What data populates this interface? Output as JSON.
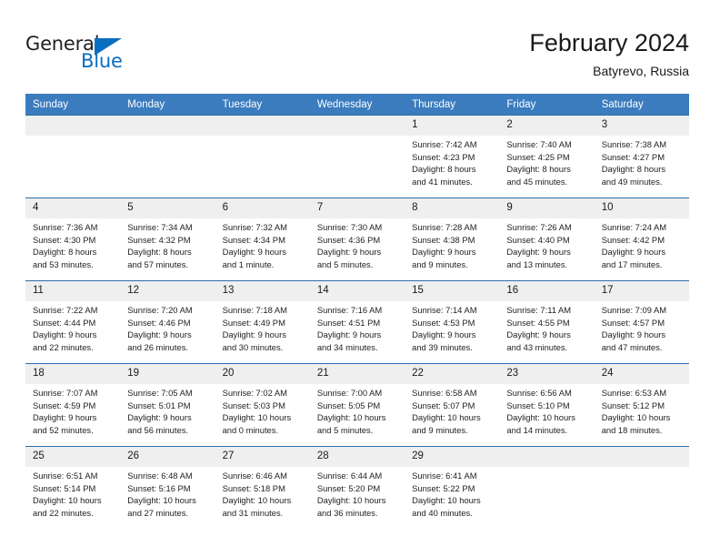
{
  "logo": {
    "word_top": "General",
    "word_bottom": "Blue",
    "triangle_icon": "blue-triangle-icon",
    "accent_color": "#0a6ec0",
    "text_color": "#231f20"
  },
  "header": {
    "title": "February 2024",
    "subtitle": "Batyrevo, Russia"
  },
  "theme": {
    "header_blue": "#3b7cbf",
    "row_divider_blue": "#2d6da8",
    "day_band_gray": "#efefef"
  },
  "weekdays": [
    "Sunday",
    "Monday",
    "Tuesday",
    "Wednesday",
    "Thursday",
    "Friday",
    "Saturday"
  ],
  "weeks": [
    [
      {
        "day": "",
        "empty": true,
        "lines": []
      },
      {
        "day": "",
        "empty": true,
        "lines": []
      },
      {
        "day": "",
        "empty": true,
        "lines": []
      },
      {
        "day": "",
        "empty": true,
        "lines": []
      },
      {
        "day": "1",
        "empty": false,
        "lines": [
          "Sunrise: 7:42 AM",
          "Sunset: 4:23 PM",
          "Daylight: 8 hours",
          "and 41 minutes."
        ]
      },
      {
        "day": "2",
        "empty": false,
        "lines": [
          "Sunrise: 7:40 AM",
          "Sunset: 4:25 PM",
          "Daylight: 8 hours",
          "and 45 minutes."
        ]
      },
      {
        "day": "3",
        "empty": false,
        "lines": [
          "Sunrise: 7:38 AM",
          "Sunset: 4:27 PM",
          "Daylight: 8 hours",
          "and 49 minutes."
        ]
      }
    ],
    [
      {
        "day": "4",
        "empty": false,
        "lines": [
          "Sunrise: 7:36 AM",
          "Sunset: 4:30 PM",
          "Daylight: 8 hours",
          "and 53 minutes."
        ]
      },
      {
        "day": "5",
        "empty": false,
        "lines": [
          "Sunrise: 7:34 AM",
          "Sunset: 4:32 PM",
          "Daylight: 8 hours",
          "and 57 minutes."
        ]
      },
      {
        "day": "6",
        "empty": false,
        "lines": [
          "Sunrise: 7:32 AM",
          "Sunset: 4:34 PM",
          "Daylight: 9 hours",
          "and 1 minute."
        ]
      },
      {
        "day": "7",
        "empty": false,
        "lines": [
          "Sunrise: 7:30 AM",
          "Sunset: 4:36 PM",
          "Daylight: 9 hours",
          "and 5 minutes."
        ]
      },
      {
        "day": "8",
        "empty": false,
        "lines": [
          "Sunrise: 7:28 AM",
          "Sunset: 4:38 PM",
          "Daylight: 9 hours",
          "and 9 minutes."
        ]
      },
      {
        "day": "9",
        "empty": false,
        "lines": [
          "Sunrise: 7:26 AM",
          "Sunset: 4:40 PM",
          "Daylight: 9 hours",
          "and 13 minutes."
        ]
      },
      {
        "day": "10",
        "empty": false,
        "lines": [
          "Sunrise: 7:24 AM",
          "Sunset: 4:42 PM",
          "Daylight: 9 hours",
          "and 17 minutes."
        ]
      }
    ],
    [
      {
        "day": "11",
        "empty": false,
        "lines": [
          "Sunrise: 7:22 AM",
          "Sunset: 4:44 PM",
          "Daylight: 9 hours",
          "and 22 minutes."
        ]
      },
      {
        "day": "12",
        "empty": false,
        "lines": [
          "Sunrise: 7:20 AM",
          "Sunset: 4:46 PM",
          "Daylight: 9 hours",
          "and 26 minutes."
        ]
      },
      {
        "day": "13",
        "empty": false,
        "lines": [
          "Sunrise: 7:18 AM",
          "Sunset: 4:49 PM",
          "Daylight: 9 hours",
          "and 30 minutes."
        ]
      },
      {
        "day": "14",
        "empty": false,
        "lines": [
          "Sunrise: 7:16 AM",
          "Sunset: 4:51 PM",
          "Daylight: 9 hours",
          "and 34 minutes."
        ]
      },
      {
        "day": "15",
        "empty": false,
        "lines": [
          "Sunrise: 7:14 AM",
          "Sunset: 4:53 PM",
          "Daylight: 9 hours",
          "and 39 minutes."
        ]
      },
      {
        "day": "16",
        "empty": false,
        "lines": [
          "Sunrise: 7:11 AM",
          "Sunset: 4:55 PM",
          "Daylight: 9 hours",
          "and 43 minutes."
        ]
      },
      {
        "day": "17",
        "empty": false,
        "lines": [
          "Sunrise: 7:09 AM",
          "Sunset: 4:57 PM",
          "Daylight: 9 hours",
          "and 47 minutes."
        ]
      }
    ],
    [
      {
        "day": "18",
        "empty": false,
        "lines": [
          "Sunrise: 7:07 AM",
          "Sunset: 4:59 PM",
          "Daylight: 9 hours",
          "and 52 minutes."
        ]
      },
      {
        "day": "19",
        "empty": false,
        "lines": [
          "Sunrise: 7:05 AM",
          "Sunset: 5:01 PM",
          "Daylight: 9 hours",
          "and 56 minutes."
        ]
      },
      {
        "day": "20",
        "empty": false,
        "lines": [
          "Sunrise: 7:02 AM",
          "Sunset: 5:03 PM",
          "Daylight: 10 hours",
          "and 0 minutes."
        ]
      },
      {
        "day": "21",
        "empty": false,
        "lines": [
          "Sunrise: 7:00 AM",
          "Sunset: 5:05 PM",
          "Daylight: 10 hours",
          "and 5 minutes."
        ]
      },
      {
        "day": "22",
        "empty": false,
        "lines": [
          "Sunrise: 6:58 AM",
          "Sunset: 5:07 PM",
          "Daylight: 10 hours",
          "and 9 minutes."
        ]
      },
      {
        "day": "23",
        "empty": false,
        "lines": [
          "Sunrise: 6:56 AM",
          "Sunset: 5:10 PM",
          "Daylight: 10 hours",
          "and 14 minutes."
        ]
      },
      {
        "day": "24",
        "empty": false,
        "lines": [
          "Sunrise: 6:53 AM",
          "Sunset: 5:12 PM",
          "Daylight: 10 hours",
          "and 18 minutes."
        ]
      }
    ],
    [
      {
        "day": "25",
        "empty": false,
        "lines": [
          "Sunrise: 6:51 AM",
          "Sunset: 5:14 PM",
          "Daylight: 10 hours",
          "and 22 minutes."
        ]
      },
      {
        "day": "26",
        "empty": false,
        "lines": [
          "Sunrise: 6:48 AM",
          "Sunset: 5:16 PM",
          "Daylight: 10 hours",
          "and 27 minutes."
        ]
      },
      {
        "day": "27",
        "empty": false,
        "lines": [
          "Sunrise: 6:46 AM",
          "Sunset: 5:18 PM",
          "Daylight: 10 hours",
          "and 31 minutes."
        ]
      },
      {
        "day": "28",
        "empty": false,
        "lines": [
          "Sunrise: 6:44 AM",
          "Sunset: 5:20 PM",
          "Daylight: 10 hours",
          "and 36 minutes."
        ]
      },
      {
        "day": "29",
        "empty": false,
        "lines": [
          "Sunrise: 6:41 AM",
          "Sunset: 5:22 PM",
          "Daylight: 10 hours",
          "and 40 minutes."
        ]
      },
      {
        "day": "",
        "empty": true,
        "lines": []
      },
      {
        "day": "",
        "empty": true,
        "lines": []
      }
    ]
  ]
}
